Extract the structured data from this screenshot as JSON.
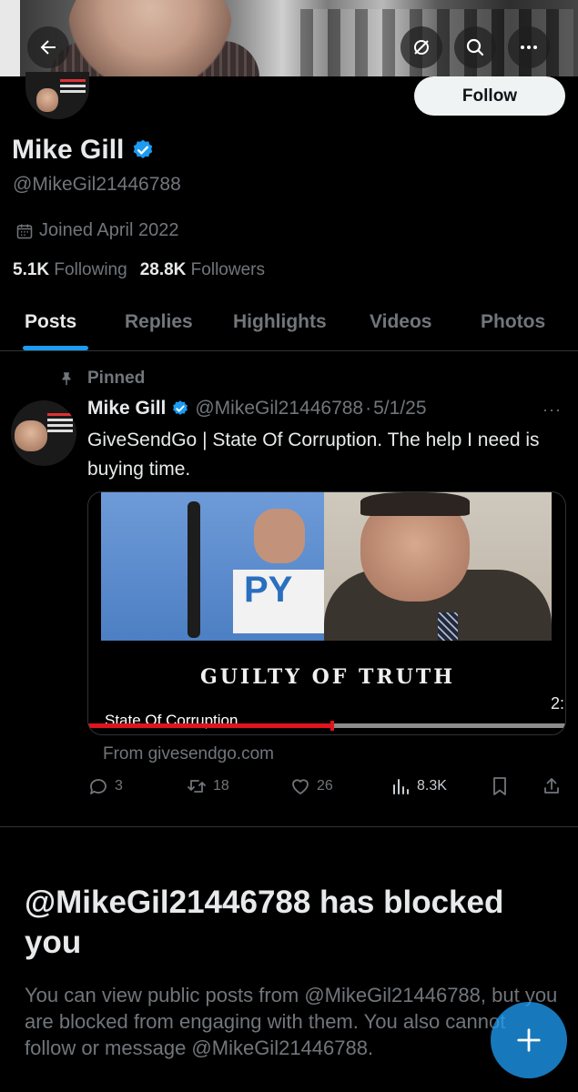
{
  "colors": {
    "accent": "#1d9bf0",
    "background": "#000000",
    "muted": "#71767b",
    "text": "#e7e9ea",
    "progress": "#e0141c"
  },
  "header": {
    "back_icon": "back-arrow-icon",
    "actions": [
      "grok-icon",
      "search-icon",
      "more-icon"
    ]
  },
  "profile": {
    "follow_label": "Follow",
    "display_name": "Mike Gill",
    "handle": "@MikeGil21446788",
    "joined": "Joined April 2022",
    "following_count": "5.1K",
    "following_label": "Following",
    "followers_count": "28.8K",
    "followers_label": "Followers"
  },
  "tabs": [
    {
      "label": "Posts",
      "active": true
    },
    {
      "label": "Replies"
    },
    {
      "label": "Highlights"
    },
    {
      "label": "Videos"
    },
    {
      "label": "Photos"
    }
  ],
  "pinned_post": {
    "pinned_label": "Pinned",
    "author_name": "Mike Gill",
    "author_handle": "@MikeGil21446788",
    "separator": "·",
    "date": "5/1/25",
    "more": "···",
    "text": "GiveSendGo | State Of Corruption.  The help I need is buying time.",
    "card": {
      "caption": "GUILTY OF TRUTH",
      "sign_text": "PY",
      "title": "State Of Corruption",
      "duration": "2:",
      "progress": 0.51
    },
    "source": "From givesendgo.com",
    "stats": {
      "replies": "3",
      "reposts": "18",
      "likes": "26",
      "views": "8.3K"
    }
  },
  "blocked": {
    "title": "@MikeGil21446788 has blocked you",
    "body": "You can view public posts from @MikeGil21446788, but you are blocked from engaging with them. You also cannot follow or message @MikeGil21446788."
  },
  "fab": {
    "icon": "plus-icon"
  }
}
